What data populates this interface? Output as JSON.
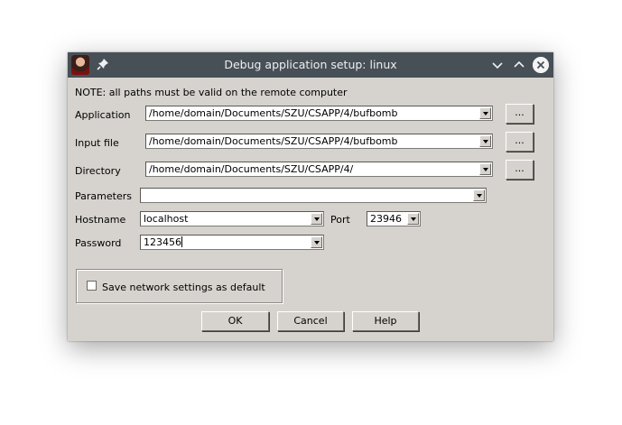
{
  "window": {
    "title": "Debug application setup: linux"
  },
  "note": "NOTE: all paths must be valid on the remote computer",
  "fields": {
    "application": {
      "label": "Application",
      "value": "/home/domain/Documents/SZU/CSAPP/4/bufbomb"
    },
    "input_file": {
      "label": "Input file",
      "value": "/home/domain/Documents/SZU/CSAPP/4/bufbomb"
    },
    "directory": {
      "label": "Directory",
      "value": "/home/domain/Documents/SZU/CSAPP/4/"
    },
    "parameters": {
      "label": "Parameters",
      "value": ""
    },
    "hostname": {
      "label": "Hostname",
      "value": "localhost"
    },
    "port": {
      "label": "Port",
      "value": "23946"
    },
    "password": {
      "label": "Password",
      "value": "123456"
    }
  },
  "browse_label": "...",
  "save_checkbox": {
    "label": "Save network settings as default",
    "checked": false
  },
  "buttons": {
    "ok": "OK",
    "cancel": "Cancel",
    "help": "Help"
  },
  "icons": {
    "app": "app-avatar-icon",
    "pin": "pin-icon",
    "minimize": "chevron-down-icon",
    "maximize": "chevron-up-icon",
    "close": "close-icon"
  },
  "colors": {
    "titlebar": "#475057",
    "dialog_bg": "#d6d3ce"
  }
}
